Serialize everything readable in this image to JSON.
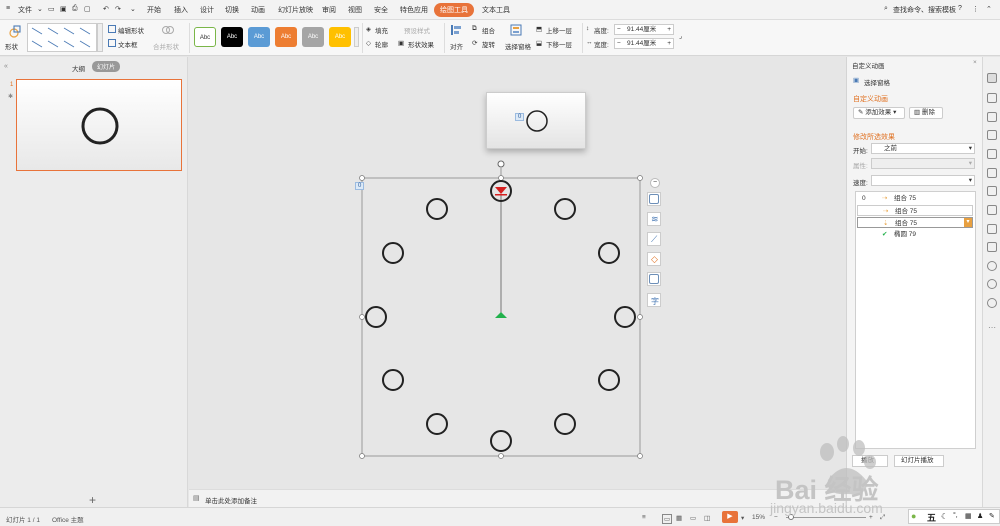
{
  "menubar": {
    "file_label": "文件",
    "tabs": [
      "开始",
      "插入",
      "设计",
      "切换",
      "动画",
      "幻灯片放映",
      "审阅",
      "视图",
      "安全",
      "特色应用",
      "绘图工具",
      "文本工具"
    ],
    "active_tab": "绘图工具",
    "search_label": "查找命令、搜索模板"
  },
  "ribbon": {
    "shape_label": "形状",
    "edit_shape": "编辑形状",
    "textbox": "文本框",
    "merge_shape": "合并形状",
    "style_label": "Abc",
    "style_colors": [
      "#ffffff",
      "#000000",
      "#5b9bd5",
      "#ed7d31",
      "#a5a5a5",
      "#ffc000"
    ],
    "fill": "填充",
    "outline": "轮廓",
    "preset_style": "预设样式",
    "shape_effect": "形状效果",
    "align": "对齐",
    "group": "组合",
    "rotate": "旋转",
    "selection_pane": "选择窗格",
    "bring_forward": "上移一层",
    "send_backward": "下移一层",
    "height_label": "高度:",
    "height_value": "91.44厘米",
    "width_label": "宽度:",
    "width_value": "91.44厘米"
  },
  "leftpanel": {
    "tab_outline": "大纲",
    "tab_slides": "幻灯片",
    "slide_number": "1"
  },
  "canvas": {
    "order_badge": "0",
    "preview_badge": "0"
  },
  "notes": {
    "placeholder": "单击此处添加备注"
  },
  "rightpanel": {
    "title": "自定义动画",
    "selection_pane": "选择窗格",
    "section_custom": "自定义动画",
    "add_effect": "添加效果",
    "delete": "删除",
    "section_modify": "修改所选效果",
    "start_label": "开始:",
    "start_value": "之前",
    "property_label": "属性:",
    "speed_label": "速度:",
    "items": [
      {
        "index": "0",
        "name": "组合 75"
      },
      {
        "index": "",
        "name": "组合 75"
      },
      {
        "index": "",
        "name": "组合 75"
      },
      {
        "index": "",
        "name": "椭圆 79"
      }
    ],
    "play_label": "播放",
    "slideshow_label": "幻灯片播放"
  },
  "statusbar": {
    "slide_info": "幻灯片 1 / 1",
    "theme": "Office 主题",
    "zoom": "15%"
  },
  "watermark": {
    "brand": "Bai 经验",
    "url": "jingyan.baidu.com"
  }
}
